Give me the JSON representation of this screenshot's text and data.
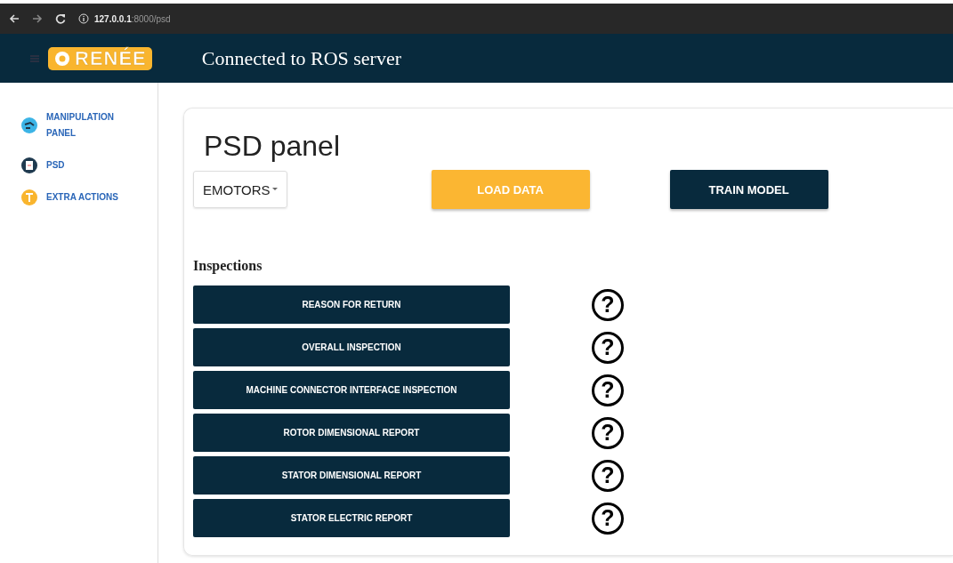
{
  "browser": {
    "url": "**127.0.0.1**:8000/psd"
  },
  "header": {
    "logo": "RENÉE",
    "title": "Connected to ROS server"
  },
  "sidebar": {
    "items": [
      {
        "label": "MANIPULATION PANEL",
        "kind": "robot"
      },
      {
        "label": "PSD",
        "kind": "document"
      },
      {
        "label": "EXTRA ACTIONS",
        "kind": "tool"
      }
    ]
  },
  "panel": {
    "title": "PSD panel",
    "dropdown": "EMOTORS",
    "buttons": [
      {
        "label": "LOAD DATA",
        "kind": "accent"
      },
      {
        "label": "TRAIN MODEL",
        "kind": "primary"
      }
    ],
    "section": "Inspections",
    "inspections": [
      {
        "label": "REASON FOR RETURN",
        "status": "?"
      },
      {
        "label": "OVERALL INSPECTION",
        "status": "?"
      },
      {
        "label": "MACHINE CONNECTOR INTERFACE INSPECTION",
        "status": "?"
      },
      {
        "label": "ROTOR DIMENSIONAL REPORT",
        "status": "?"
      },
      {
        "label": "STATOR DIMENSIONAL REPORT",
        "status": "?"
      },
      {
        "label": "STATOR ELECTRIC REPORT",
        "status": "?"
      }
    ]
  }
}
